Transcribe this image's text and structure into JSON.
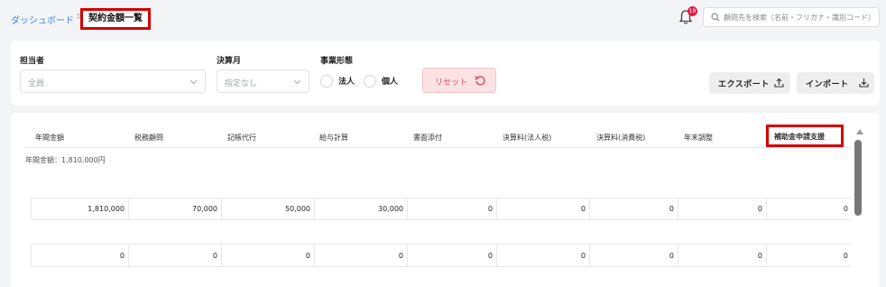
{
  "breadcrumb": {
    "home": "ダッシュボード",
    "separator": ">",
    "current": "契約金額一覧"
  },
  "notifications": {
    "count": "19"
  },
  "search": {
    "placeholder": "顧問先を検索（名前・フリガナ・識別コード）"
  },
  "filters": {
    "assignee": {
      "label": "担当者",
      "value": "全員"
    },
    "month": {
      "label": "決算月",
      "value": "指定なし"
    },
    "business": {
      "label": "事業形態",
      "options": [
        "法人",
        "個人"
      ]
    },
    "reset_label": "リセット",
    "export_label": "エクスポート",
    "import_label": "インポート"
  },
  "table": {
    "columns": [
      "年間金額",
      "税務顧問",
      "記帳代行",
      "給与計算",
      "書面添付",
      "決算料(法人税)",
      "決算料(消費税)",
      "年末調整",
      "補助金申請支援"
    ],
    "group_label": "年間金額：1,810,000円",
    "rows": [
      [
        "1,810,000",
        "70,000",
        "50,000",
        "30,000",
        "0",
        "0",
        "0",
        "0",
        "0"
      ],
      [
        "0",
        "0",
        "0",
        "0",
        "0",
        "0",
        "0",
        "0",
        "0"
      ]
    ]
  },
  "colors": {
    "accent": "#3b82f6",
    "highlight": "#d40000",
    "reset": "#d94b5f",
    "badge": "#e11d48"
  }
}
